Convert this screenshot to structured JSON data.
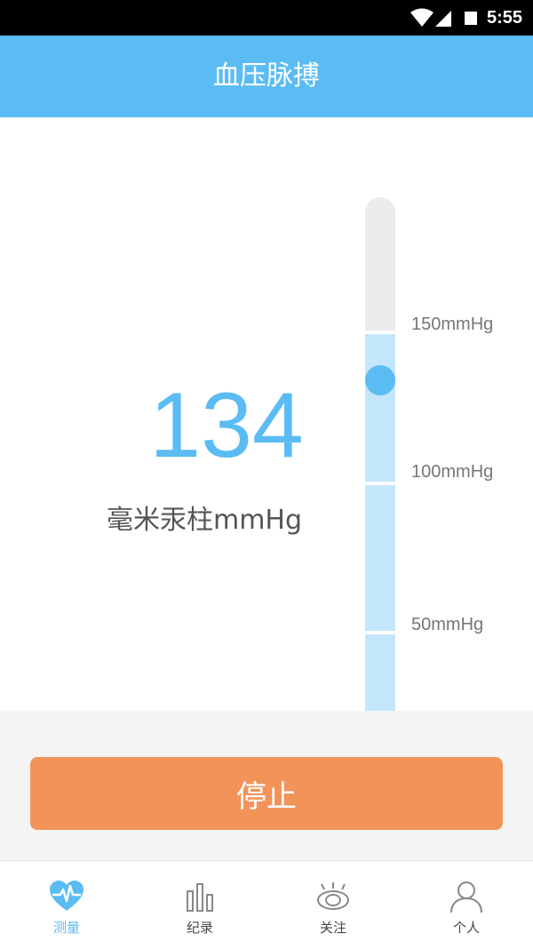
{
  "status_bar": {
    "time": "5:55"
  },
  "header": {
    "title": "血压脉搏"
  },
  "reading": {
    "value": "134",
    "unit": "毫米汞柱mmHg"
  },
  "gauge": {
    "current_mmHg": 134,
    "max_mmHg": 200,
    "labels": [
      "150mmHg",
      "100mmHg",
      "50mmHg"
    ]
  },
  "actions": {
    "stop_label": "停止"
  },
  "tabs": [
    {
      "label": "测量",
      "icon": "heart-pulse-icon",
      "active": true
    },
    {
      "label": "纪录",
      "icon": "bar-chart-icon",
      "active": false
    },
    {
      "label": "关注",
      "icon": "eye-icon",
      "active": false
    },
    {
      "label": "个人",
      "icon": "person-icon",
      "active": false
    }
  ],
  "colors": {
    "accent": "#5bbcf3",
    "gauge_fill": "#c3e6fb",
    "gauge_track": "#ebebed",
    "stop_button": "#f2945a",
    "inactive_icon": "#888888"
  }
}
